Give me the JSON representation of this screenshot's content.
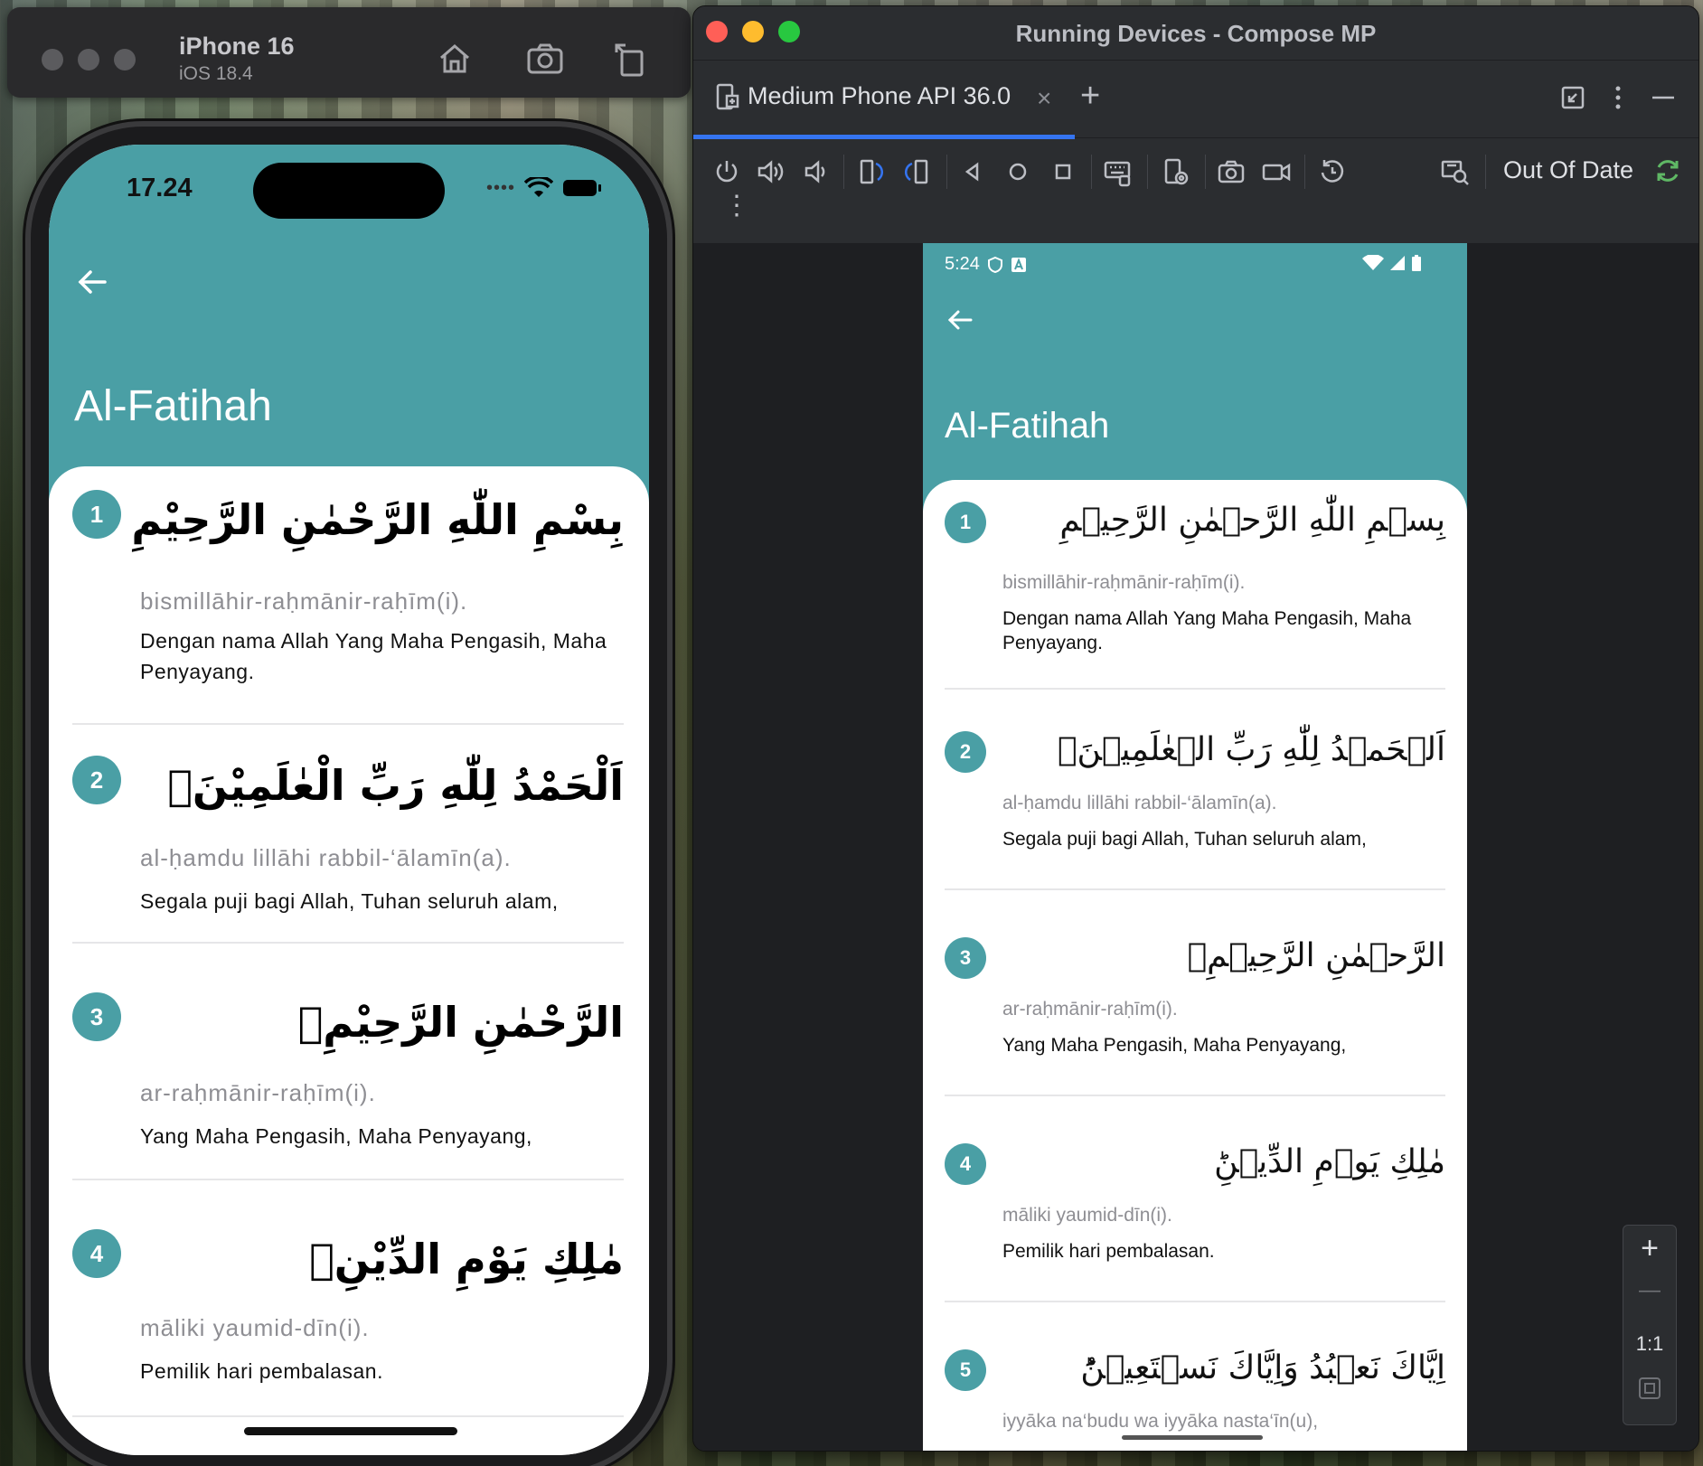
{
  "colors": {
    "teal": "#4a9fa5",
    "accent_blue": "#3574f0",
    "refresh_green": "#5fb865"
  },
  "simulator": {
    "device_name": "iPhone 16",
    "os_version": "iOS 18.4",
    "time": "17.24",
    "buttons": [
      "home-icon",
      "screenshot-icon",
      "rotate-icon"
    ]
  },
  "ios_app": {
    "title": "Al-Fatihah",
    "verses": [
      {
        "number": "1",
        "arabic": "بِسْمِ اللّٰهِ الرَّحْمٰنِ الرَّحِيْمِ",
        "latin": "bismillāhir-raḥmānir-raḥīm(i).",
        "translation": "Dengan nama Allah Yang Maha Pengasih, Maha Penyayang."
      },
      {
        "number": "2",
        "arabic": "اَلْحَمْدُ لِلّٰهِ رَبِّ الْعٰلَمِيْنَۙ",
        "latin": "al-ḥamdu lillāhi rabbil-‘ālamīn(a).",
        "translation": "Segala puji bagi Allah, Tuhan seluruh alam,"
      },
      {
        "number": "3",
        "arabic": "الرَّحْمٰنِ الرَّحِيْمِۙ",
        "latin": "ar-raḥmānir-raḥīm(i).",
        "translation": "Yang Maha Pengasih, Maha Penyayang,"
      },
      {
        "number": "4",
        "arabic": "مٰلِكِ يَوْمِ الدِّيْنِۗ",
        "latin": "māliki yaumid-dīn(i).",
        "translation": "Pemilik hari pembalasan."
      }
    ]
  },
  "android_studio": {
    "window_title": "Running Devices - Compose MP",
    "tab_label": "Medium Phone API 36.0",
    "tab_close": "×",
    "tab_add": "+",
    "status_label": "Out Of Date",
    "zoom_plus": "+",
    "zoom_minus": "—",
    "zoom_ratio": "1:1"
  },
  "android_app": {
    "time": "5:24",
    "title": "Al-Fatihah",
    "verses": [
      {
        "number": "1",
        "arabic": "بِسۡمِ اللّٰهِ الرَّحۡمٰنِ الرَّحِيۡمِ",
        "latin": "bismillāhir-raḥmānir-raḥīm(i).",
        "translation": "Dengan nama Allah Yang Maha Pengasih, Maha Penyayang."
      },
      {
        "number": "2",
        "arabic": "اَلۡحَمۡدُ لِلّٰهِ رَبِّ الۡعٰلَمِيۡنَۙ",
        "latin": "al-ḥamdu lillāhi rabbil-‘ālamīn(a).",
        "translation": "Segala puji bagi Allah, Tuhan seluruh alam,"
      },
      {
        "number": "3",
        "arabic": "الرَّحۡمٰنِ الرَّحِيۡمِۙ",
        "latin": "ar-raḥmānir-raḥīm(i).",
        "translation": "Yang Maha Pengasih, Maha Penyayang,"
      },
      {
        "number": "4",
        "arabic": "مٰلِكِ يَوۡمِ الدِّيۡنِؕ",
        "latin": "māliki yaumid-dīn(i).",
        "translation": "Pemilik hari pembalasan."
      },
      {
        "number": "5",
        "arabic": "اِيَّاكَ نَعۡبُدُ وَاِيَّاكَ نَسۡتَعِيۡنُؕ",
        "latin": "iyyāka na‘budu wa iyyāka nasta‘īn(u),",
        "translation": ""
      }
    ]
  }
}
